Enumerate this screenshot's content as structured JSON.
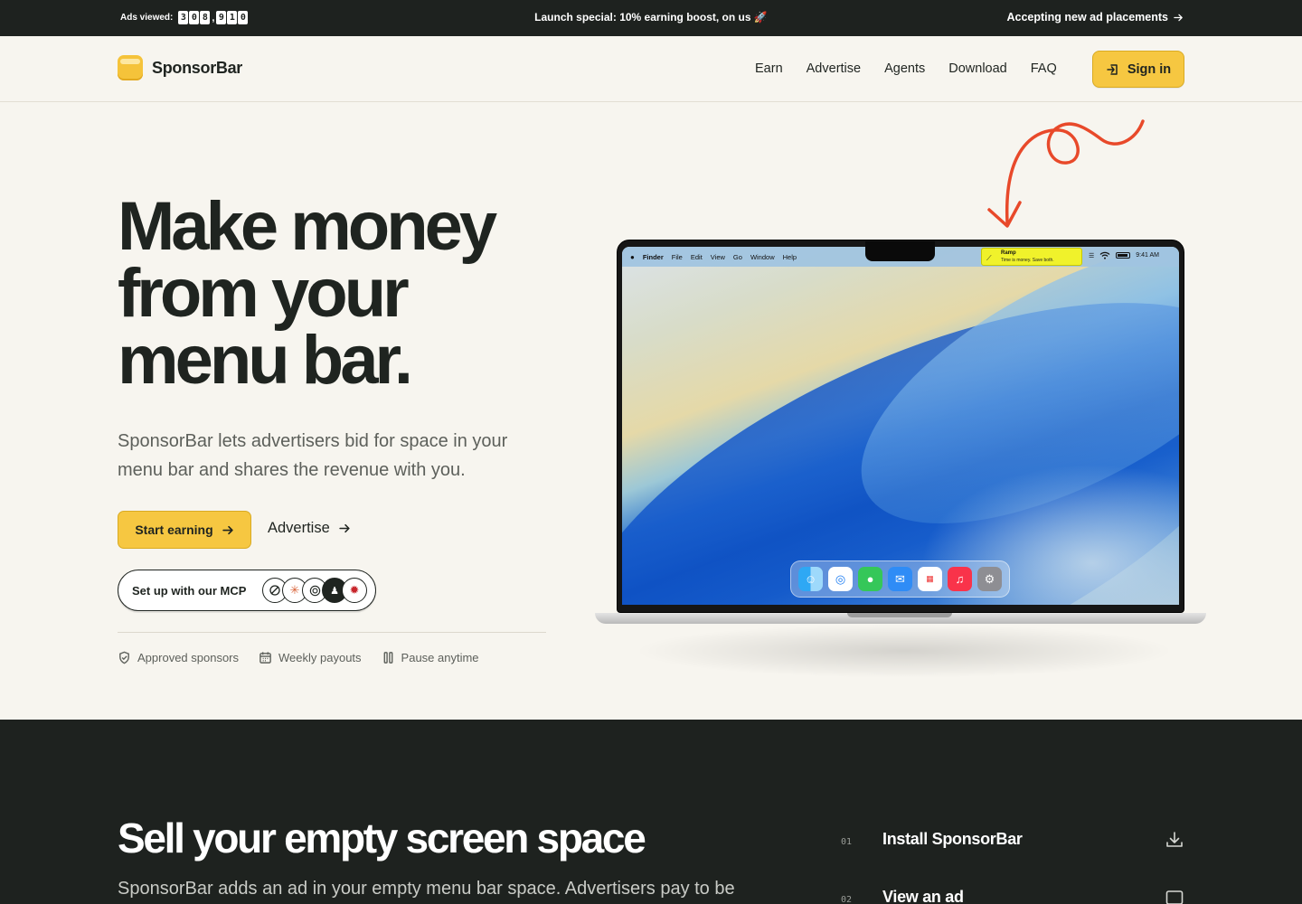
{
  "topbar": {
    "ads_viewed_label": "Ads viewed:",
    "ads_viewed_digits_a": [
      "3",
      "0",
      "8"
    ],
    "ads_viewed_digits_b": [
      "9",
      "1",
      "0"
    ],
    "ads_viewed_separator": ",",
    "promo_prefix": "Launch special: ",
    "promo_bold": "10% earning boost, on us",
    "promo_emoji": "🚀",
    "accepting_link": "Accepting new ad placements",
    "arrow": "→"
  },
  "header": {
    "brand": "SponsorBar",
    "nav": [
      "Earn",
      "Advertise",
      "Agents",
      "Download",
      "FAQ"
    ],
    "sign_in": "Sign in"
  },
  "hero": {
    "title_line1": "Make money",
    "title_line2": "from your",
    "title_line3": "menu bar.",
    "subtitle": "SponsorBar lets advertisers bid for space in your menu bar and shares the revenue with you.",
    "start_button": "Start earning",
    "advertise_link": "Advertise",
    "mcp_label": "Set up with our MCP",
    "features": [
      "Approved sponsors",
      "Weekly payouts",
      "Pause anytime"
    ]
  },
  "laptop": {
    "menubar_items": [
      "Finder",
      "File",
      "Edit",
      "View",
      "Go",
      "Window",
      "Help"
    ],
    "ad_title": "Ramp",
    "ad_subtitle": "Time is money. Save both.",
    "clock": "9:41 AM",
    "dock_icons": [
      "finder-icon",
      "safari-icon",
      "messages-icon",
      "mail-icon",
      "calendar-icon",
      "music-icon",
      "settings-icon"
    ]
  },
  "section2": {
    "title": "Sell your empty screen space",
    "subtitle": "SponsorBar adds an ad in your empty menu bar space. Advertisers pay to be",
    "steps": [
      {
        "num": "01",
        "label": "Install SponsorBar"
      },
      {
        "num": "02",
        "label": "View an ad"
      }
    ]
  },
  "colors": {
    "accent": "#f6c741",
    "dark": "#1e221f",
    "background": "#f7f5ef",
    "squiggle": "#e8492a"
  }
}
